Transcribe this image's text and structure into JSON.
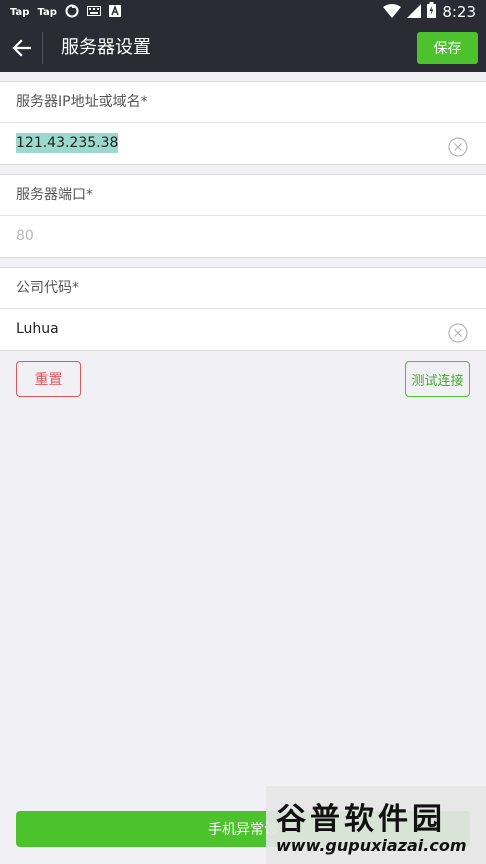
{
  "statusbar": {
    "apps": [
      "Tap",
      "Tap"
    ],
    "time": "8:23"
  },
  "appbar": {
    "title": "服务器设置",
    "save_label": "保存"
  },
  "server": {
    "label": "服务器IP地址或域名*",
    "value": "121.43.235.38"
  },
  "port": {
    "label": "服务器端口*",
    "placeholder": "80"
  },
  "company": {
    "label": "公司代码*",
    "value": "Luhua"
  },
  "actions": {
    "reset_label": "重置",
    "test_label": "测试连接",
    "diagnose_label": "手机异常诊"
  },
  "watermark": {
    "name": "谷普软件园",
    "url": "www.gupuxiazai.com"
  },
  "colors": {
    "appbar": "#2b2b33",
    "accent_green": "#4cc22c",
    "danger_red": "#e0575a",
    "background": "#f1f0f5"
  }
}
